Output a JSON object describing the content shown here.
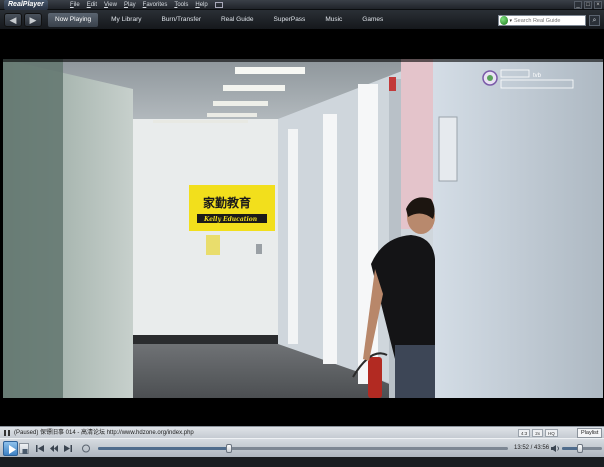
{
  "app": {
    "logo": "RealPlayer"
  },
  "menus": [
    "File",
    "Edit",
    "View",
    "Play",
    "Favorites",
    "Tools",
    "Help"
  ],
  "nav": {
    "back_glyph": "◀",
    "forward_glyph": "▶",
    "tabs": [
      {
        "label": "Now Playing",
        "active": true
      },
      {
        "label": "My Library",
        "active": false
      },
      {
        "label": "Burn/Transfer",
        "active": false
      },
      {
        "label": "Real Guide",
        "active": false
      },
      {
        "label": "SuperPass",
        "active": false
      },
      {
        "label": "Music",
        "active": false
      },
      {
        "label": "Games",
        "active": false
      }
    ]
  },
  "search": {
    "placeholder": "Search Real Guide",
    "go_glyph": "⌕"
  },
  "window": {
    "minimize": "_",
    "maximize": "□",
    "close": "×"
  },
  "video": {
    "sign_cn": "家勤教育",
    "sign_en": "Kelly Education",
    "watermark_text": "tvb"
  },
  "status": {
    "text": "(Paused) 保镖旧事 014 - 高清论坛 http://www.hdzone.org/index.php",
    "mini_buttons": [
      "4:3",
      "2x",
      "HQ"
    ],
    "playlist_label": "Playlist"
  },
  "playback": {
    "position_fraction": 0.32,
    "time": "13:52 / 43:56",
    "volume_fraction": 0.45
  },
  "colors": {
    "accent": "#3e82c4",
    "chrome_dark": "#1f2329",
    "sign_yellow": "#f2df1c"
  }
}
